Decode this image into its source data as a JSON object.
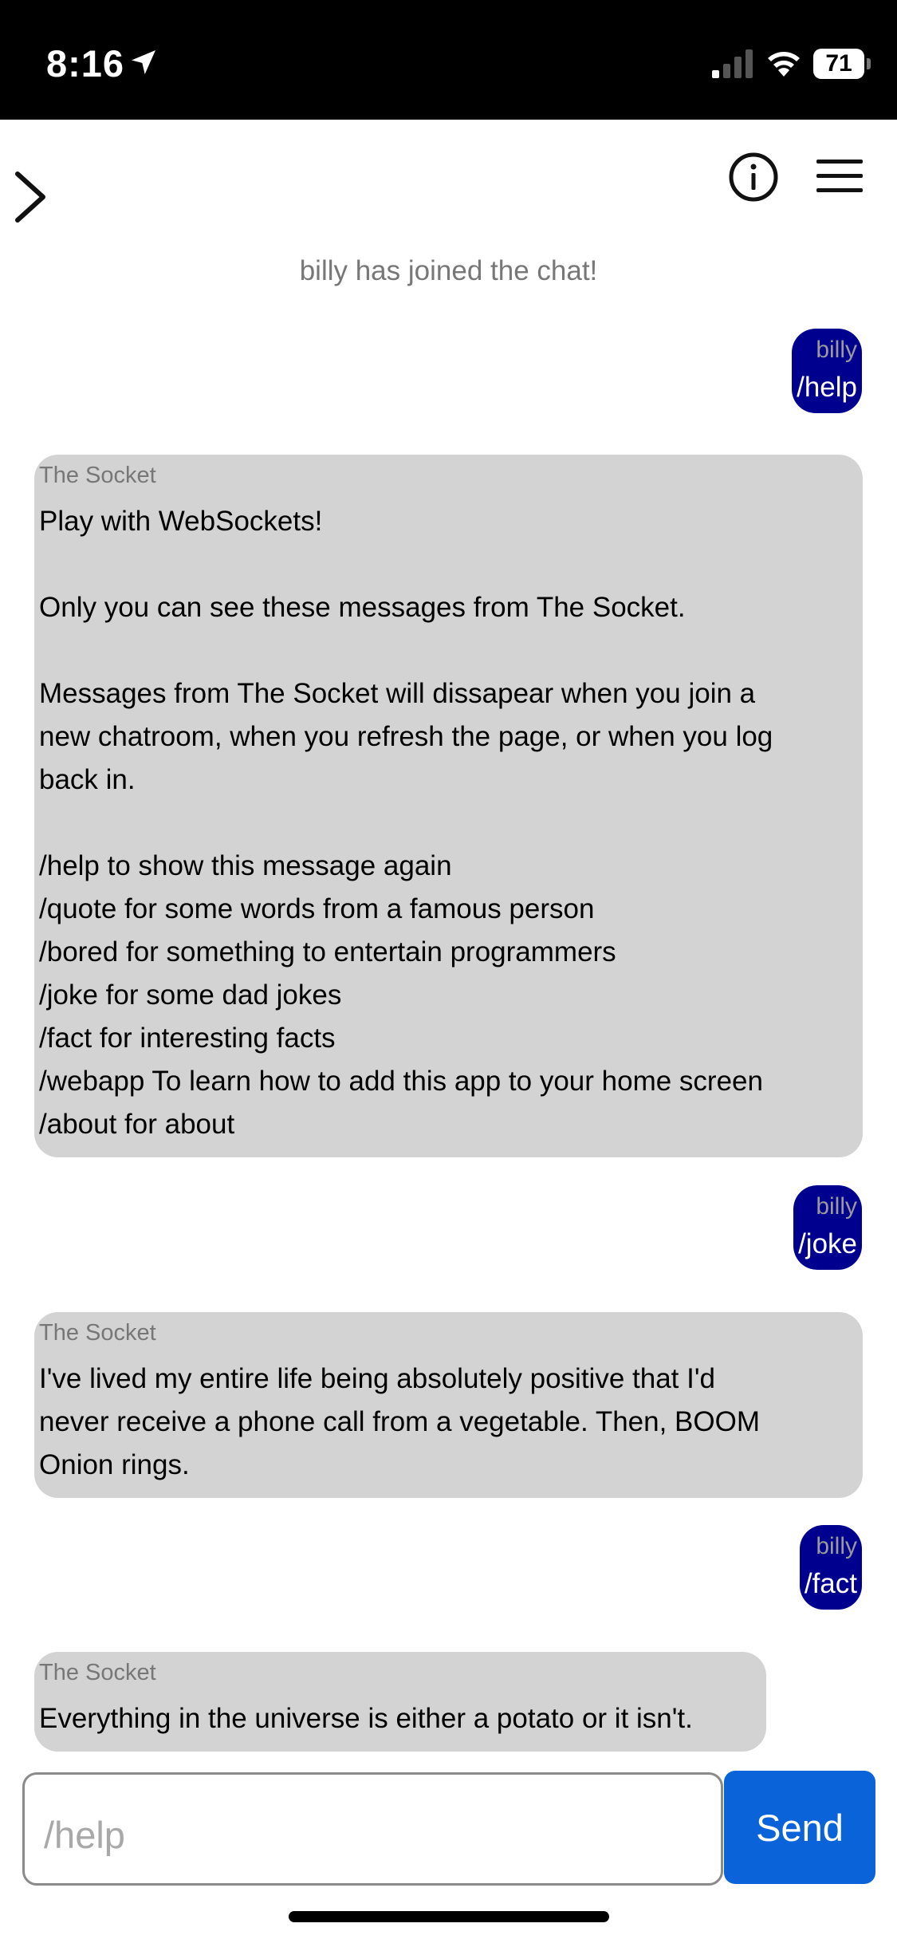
{
  "status_bar": {
    "time": "8:16",
    "battery": "71"
  },
  "chat": {
    "system_message": "billy has joined the chat!",
    "messages": [
      {
        "sender": "billy",
        "text": "/help"
      },
      {
        "sender": "The Socket",
        "lines": [
          "Play with WebSockets!",
          "",
          "Only you can see these messages from The Socket.",
          "",
          "Messages from The Socket will dissapear when you join a",
          "new chatroom, when you refresh the page, or when you log",
          "back in.",
          "",
          "/help to show this message again",
          "/quote for some words from a famous person",
          "/bored for something to entertain programmers",
          "/joke for some dad jokes",
          "/fact for interesting facts",
          "/webapp To learn how to add this app to your home screen",
          "/about for about"
        ]
      },
      {
        "sender": "billy",
        "text": "/joke"
      },
      {
        "sender": "The Socket",
        "lines": [
          "I've lived my entire life being absolutely positive that I'd",
          "never receive a phone call from a vegetable. Then, BOOM",
          "Onion rings."
        ]
      },
      {
        "sender": "billy",
        "text": "/fact"
      },
      {
        "sender": "The Socket",
        "lines": [
          "Everything in the universe is either a potato or it isn't."
        ]
      }
    ]
  },
  "input": {
    "placeholder": "/help",
    "value": "",
    "send_label": "Send"
  },
  "colors": {
    "self_bubble": "#00008f",
    "bot_bubble": "#d3d3d3",
    "send_button": "#0b63d9"
  },
  "icons": [
    "location-arrow-icon",
    "signal-icon",
    "wifi-icon",
    "battery-icon",
    "chevron-right-icon",
    "info-icon",
    "menu-icon"
  ]
}
